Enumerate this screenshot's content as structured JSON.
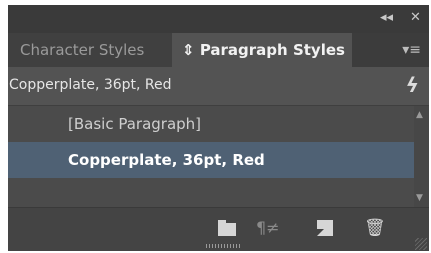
{
  "titlebar": {
    "collapse_icon": "double-left-arrow-icon",
    "collapse_glyph": "◂◂",
    "close_icon": "close-icon",
    "close_glyph": "✕"
  },
  "tabs": [
    {
      "label": "Character Styles",
      "active": false
    },
    {
      "label": "Paragraph Styles",
      "active": true,
      "prefix": "⇕"
    }
  ],
  "panel_menu": {
    "icon": "panel-menu-icon",
    "glyph": "▾≡"
  },
  "style_bar": {
    "current_style": "Copperplate, 36pt, Red",
    "icon": "lightning-bolt-icon",
    "glyph": "ϟ"
  },
  "list_items": [
    {
      "label": "[Basic Paragraph]",
      "selected": false
    },
    {
      "label": "Copperplate, 36pt, Red",
      "selected": true
    }
  ],
  "bottom_toolbar": {
    "buttons": [
      {
        "name": "new-style-group-icon",
        "glyph": ""
      },
      {
        "name": "clear-overrides-icon",
        "glyph": "¶≠"
      },
      {
        "name": "create-new-style-icon",
        "glyph": ""
      },
      {
        "name": "delete-icon",
        "glyph": "🗑"
      }
    ]
  },
  "colors": {
    "panel_bg": "#535353",
    "tabbar_bg": "#3c3c3c",
    "selected_row": "#4f6174",
    "text_light": "#e6e6e6"
  }
}
